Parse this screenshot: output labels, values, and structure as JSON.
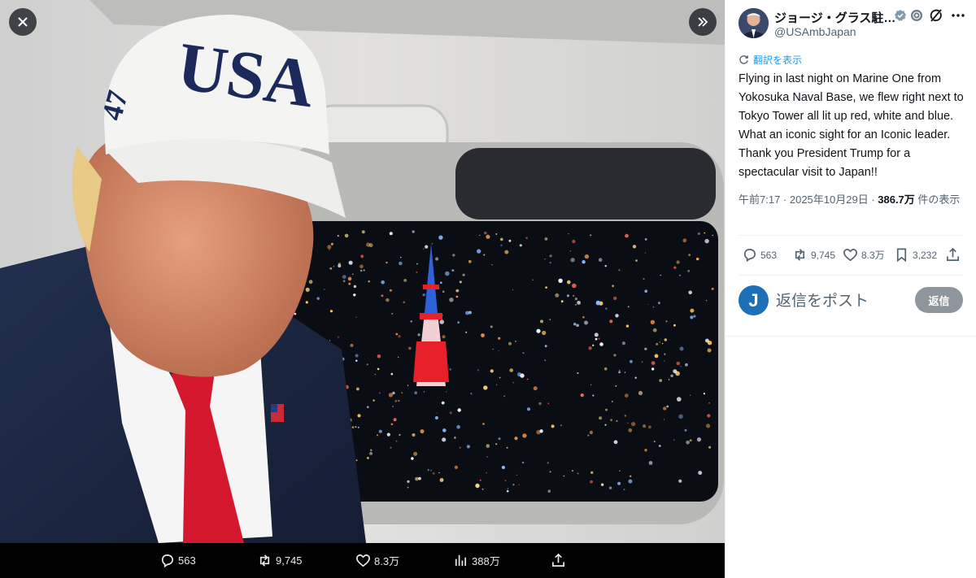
{
  "media": {
    "cap_text": "USA",
    "cap_side_text": "47",
    "close_icon": "close-icon",
    "expand_icon": "double-chevron-right-icon",
    "actions": {
      "replies": "563",
      "reposts": "9,745",
      "likes": "8.3万",
      "views": "388万"
    }
  },
  "post": {
    "display_name": "ジョージ・グラス駐…",
    "handle": "@USAmbJapan",
    "translate_label": "翻訳を表示",
    "text": "Flying in last night on Marine One from Yokosuka Naval Base, we flew right next to Tokyo Tower all lit up red, white and blue.  What an iconic sight for an Iconic leader.   Thank you President Trump for a spectacular visit to Japan!!",
    "timestamp": "午前7:17 · 2025年10月29日 · ",
    "views_count": "386.7万",
    "views_suffix": " 件の表示",
    "actions": {
      "replies": "563",
      "reposts": "9,745",
      "likes": "8.3万",
      "bookmarks": "3,232"
    }
  },
  "reply": {
    "avatar_letter": "J",
    "placeholder": "返信をポスト",
    "button_label": "返信"
  },
  "colors": {
    "accent": "#1d9bf0",
    "verified": "#829aab",
    "reply_button": "#8e959c",
    "tower_red": "#e8202a",
    "tower_blue": "#2f62d8"
  }
}
